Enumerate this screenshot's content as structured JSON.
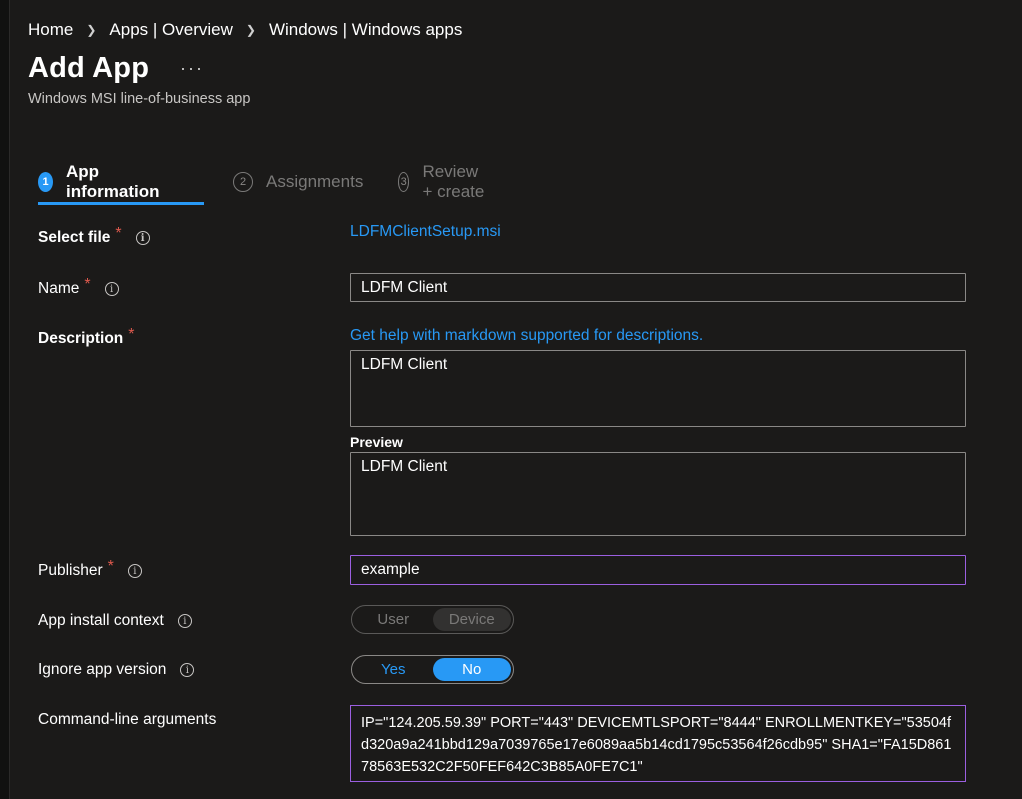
{
  "breadcrumb": [
    "Home",
    "Apps | Overview",
    "Windows | Windows apps"
  ],
  "page": {
    "title": "Add App",
    "more": "···",
    "subtitle": "Windows MSI line-of-business app"
  },
  "tabs": [
    {
      "num": "1",
      "label": "App information",
      "active": true
    },
    {
      "num": "2",
      "label": "Assignments",
      "active": false
    },
    {
      "num": "3",
      "label": "Review + create",
      "active": false
    }
  ],
  "form": {
    "select_file": {
      "label": "Select file",
      "required": "*",
      "value": "LDFMClientSetup.msi"
    },
    "name": {
      "label": "Name",
      "required": "*",
      "value": "LDFM Client"
    },
    "description": {
      "label": "Description",
      "required": "*",
      "help_link": "Get help with markdown supported for descriptions.",
      "value": "LDFM Client",
      "preview_label": "Preview",
      "preview_value": "LDFM Client"
    },
    "publisher": {
      "label": "Publisher",
      "required": "*",
      "value": "example"
    },
    "install_context": {
      "label": "App install context",
      "options": [
        "User",
        "Device"
      ],
      "selected": "Device"
    },
    "ignore_version": {
      "label": "Ignore app version",
      "options": [
        "Yes",
        "No"
      ],
      "selected": "No"
    },
    "cmdline": {
      "label": "Command-line arguments",
      "value": "IP=\"124.205.59.39\" PORT=\"443\" DEVICEMTLSPORT=\"8444\" ENROLLMENTKEY=\"53504fd320a9a241bbd129a7039765e17e6089aa5b14cd1795c53564f26cdb95\" SHA1=\"FA15D86178563E532C2F50FEF642C3B85A0FE7C1\""
    }
  },
  "icons": {
    "info": "info-icon",
    "chevron": "chevron-right-icon"
  },
  "colors": {
    "accent": "#2899f5",
    "required": "#e05a4e",
    "focus_border": "#9b5fe0",
    "background": "#1b1a19"
  }
}
